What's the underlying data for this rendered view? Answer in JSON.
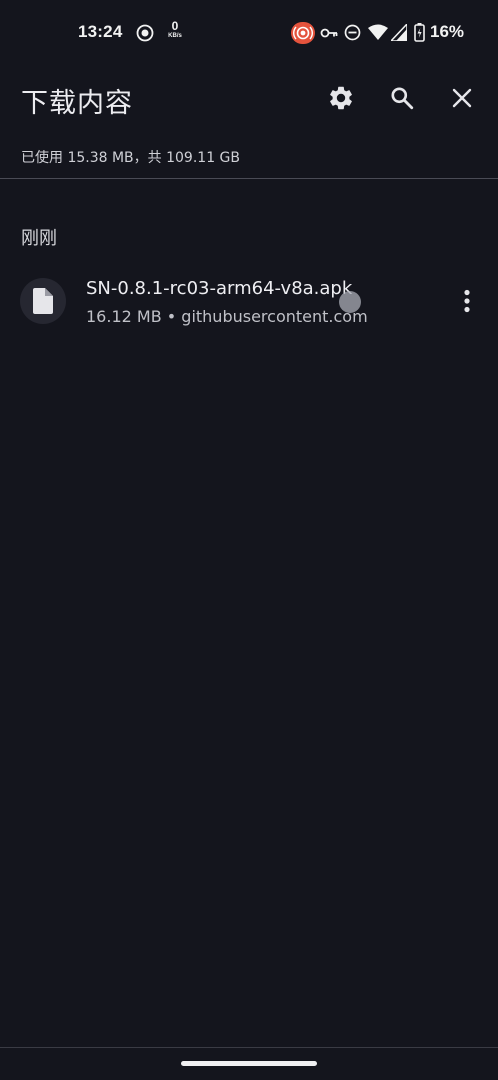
{
  "status_bar": {
    "time": "13:24",
    "net_speed_value": "0",
    "net_speed_unit": "KB/s",
    "battery_percent": "16%",
    "icons": [
      "screen-record-icon",
      "cast-icon",
      "vpn-key-icon",
      "do-not-disturb-icon",
      "wifi-icon",
      "cell-signal-icon",
      "battery-icon"
    ],
    "cast_color": "#e4533d"
  },
  "app_bar": {
    "title": "下载内容",
    "actions": [
      "gear-icon",
      "search-icon",
      "close-icon"
    ]
  },
  "storage_summary": "已使用 15.38 MB，共 109.11 GB",
  "sections": [
    {
      "label": "刚刚",
      "items": [
        {
          "filename": "SN-0.8.1-rc03-arm64-v8a.apk",
          "meta": "16.12 MB • githubusercontent.com",
          "icon": "file-icon"
        }
      ]
    }
  ],
  "colors": {
    "background": "#14151d",
    "text_primary": "#eeeef2",
    "text_secondary": "#bfc0c7",
    "divider": "#4a4b55"
  }
}
